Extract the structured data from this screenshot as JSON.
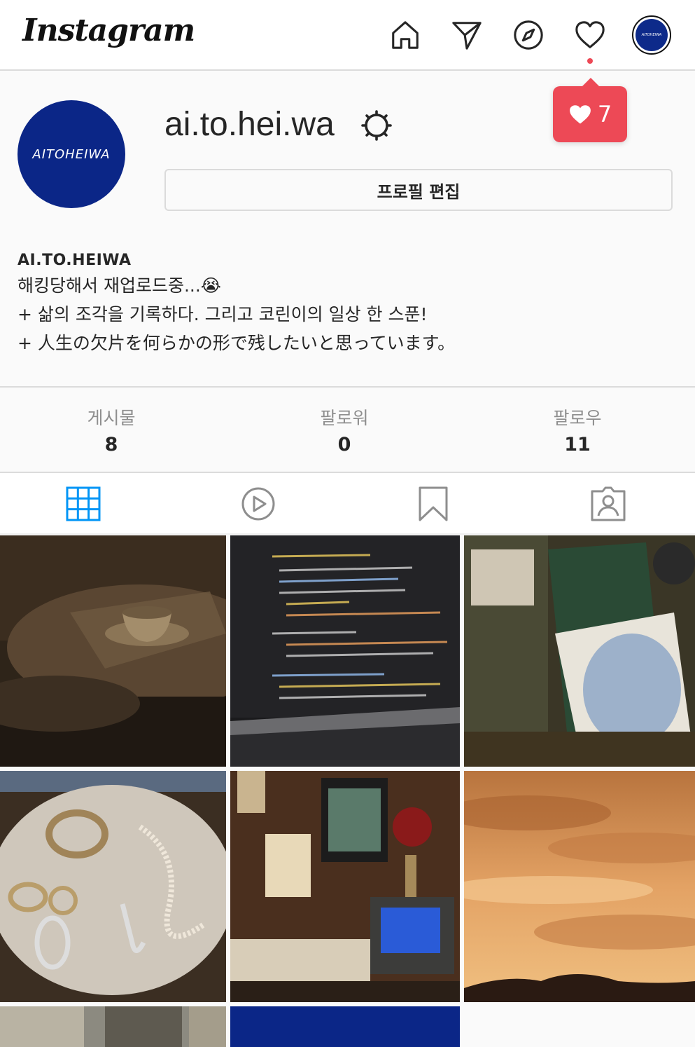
{
  "header": {
    "logo_text": "Instagram",
    "nav": [
      {
        "name": "home-icon"
      },
      {
        "name": "direct-send-icon"
      },
      {
        "name": "explore-compass-icon"
      },
      {
        "name": "activity-heart-icon"
      }
    ],
    "avatar_text": "AITOHEIWA"
  },
  "notification_popup": {
    "icon": "heart-icon",
    "count": "7",
    "color": "#ed4956"
  },
  "profile": {
    "avatar_text": "AITOHEIWA",
    "username": "ai.to.hei.wa",
    "edit_button_label": "프로필 편집",
    "bio_name": "AI.TO.HEIWA",
    "bio_lines": [
      "해킹당해서 재업로드중...😭",
      "+ 삶의 조각을 기록하다. 그리고 코린이의 일상 한 스푼!",
      "+ 人生の欠片を何らかの形で残したいと思っています。"
    ]
  },
  "stats": [
    {
      "label": "게시물",
      "value": "8"
    },
    {
      "label": "팔로워",
      "value": "0"
    },
    {
      "label": "팔로우",
      "value": "11"
    }
  ],
  "tabs": [
    {
      "name": "grid-icon",
      "active": true
    },
    {
      "name": "reels-play-icon",
      "active": false
    },
    {
      "name": "saved-bookmark-icon",
      "active": false
    },
    {
      "name": "tagged-portrait-icon",
      "active": false
    }
  ],
  "colors": {
    "accent_blue": "#0095f6",
    "brand_navy": "#0b2687",
    "border": "#dbdbdb",
    "muted_text": "#8e8e8e"
  }
}
